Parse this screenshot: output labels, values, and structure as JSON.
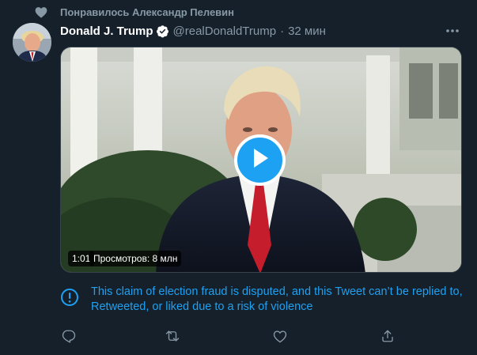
{
  "social_context": {
    "text": "Понравилось Александр Пелевин",
    "icon": "heart-icon"
  },
  "tweet": {
    "author_name": "Donald J. Trump",
    "verified": true,
    "handle": "@realDonaldTrump",
    "separator": "·",
    "time": "32 мин",
    "more_icon": "more-icon"
  },
  "media": {
    "duration": "1:01",
    "views": "Просмотров: 8 млн",
    "play_icon": "play-icon"
  },
  "notice": {
    "icon": "exclamation-circle-icon",
    "text": "This claim of election fraud is disputed, and this Tweet can’t be replied to, Retweeted, or liked due to a risk of violence"
  },
  "actions": [
    "reply-icon",
    "retweet-icon",
    "like-icon",
    "share-icon"
  ],
  "colors": {
    "background": "#15202b",
    "accent": "#1da1f2",
    "muted": "#8899a6"
  }
}
